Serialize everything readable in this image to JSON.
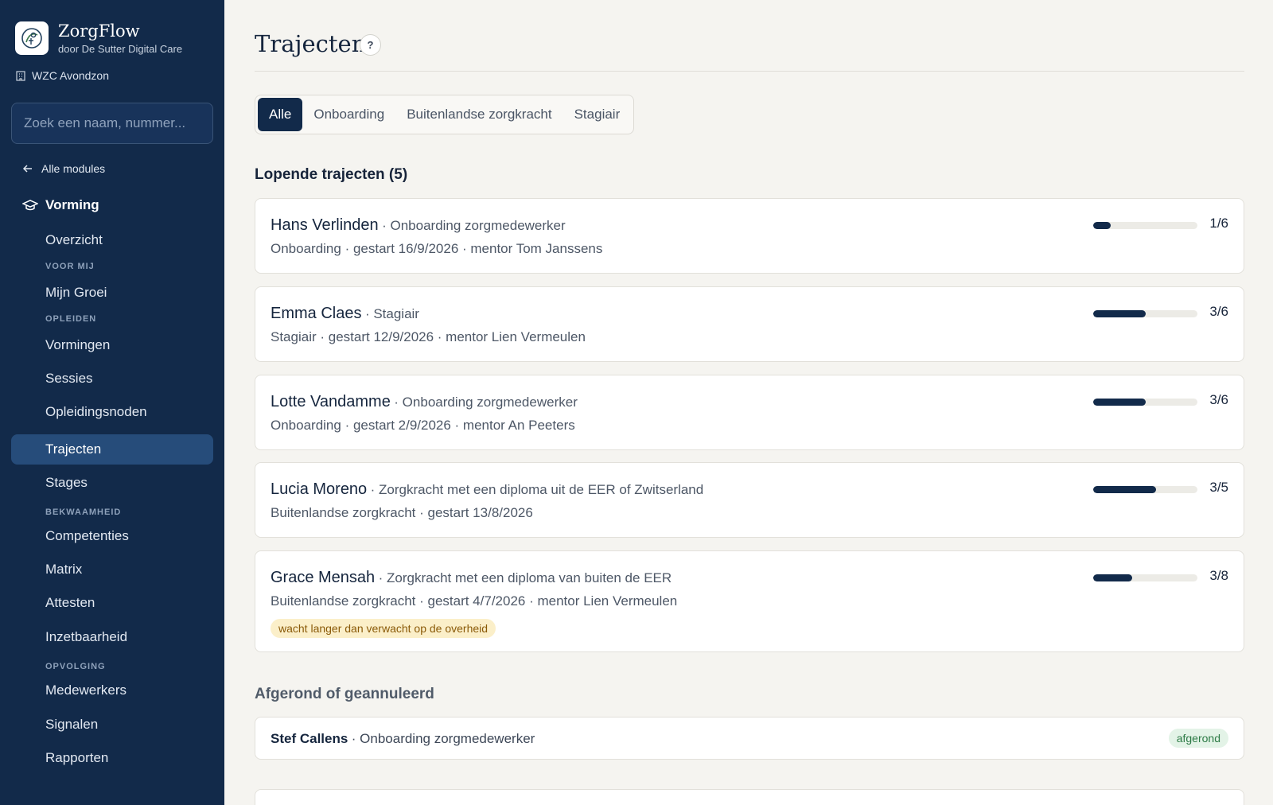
{
  "brand": {
    "name": "ZorgFlow",
    "subtitle": "door De Sutter Digital Care",
    "facility": "WZC Avondzon"
  },
  "search": {
    "placeholder": "Zoek een naam, nummer..."
  },
  "nav": {
    "back_label": "Alle modules",
    "module_label": "Vorming",
    "items": [
      {
        "label": "Overzicht"
      },
      {
        "label": "Mijn Groei"
      },
      {
        "label": "Vormingen"
      },
      {
        "label": "Sessies"
      },
      {
        "label": "Opleidingsnoden"
      },
      {
        "label": "Trajecten",
        "active": true
      },
      {
        "label": "Stages"
      },
      {
        "label": "Competenties"
      },
      {
        "label": "Matrix"
      },
      {
        "label": "Attesten"
      },
      {
        "label": "Inzetbaarheid"
      },
      {
        "label": "Medewerkers"
      },
      {
        "label": "Signalen"
      },
      {
        "label": "Rapporten"
      }
    ],
    "sections": [
      "VOOR MIJ",
      "OPLEIDEN",
      "BEKWAAMHEID",
      "OPVOLGING"
    ]
  },
  "page": {
    "title": "Trajecten",
    "help_label": "?"
  },
  "tabs": [
    {
      "label": "Alle",
      "active": true
    },
    {
      "label": "Onboarding"
    },
    {
      "label": "Buitenlandse zorgkracht"
    },
    {
      "label": "Stagiair"
    }
  ],
  "running": {
    "title": "Lopende trajecten (5)",
    "items": [
      {
        "name": "Hans Verlinden",
        "type": "· Onboarding zorgmedewerker",
        "details": "Onboarding · gestart 16/9/2026 · mentor Tom Janssens",
        "count": "1/6",
        "progress": 0.1667
      },
      {
        "name": "Emma Claes",
        "type": "· Stagiair",
        "details": "Stagiair · gestart 12/9/2026 · mentor Lien Vermeulen",
        "count": "3/6",
        "progress": 0.5
      },
      {
        "name": "Lotte Vandamme",
        "type": "· Onboarding zorgmedewerker",
        "details": "Onboarding · gestart 2/9/2026 · mentor An Peeters",
        "count": "3/6",
        "progress": 0.5
      },
      {
        "name": "Lucia Moreno",
        "type": "· Zorgkracht met een diploma uit de EER of Zwitserland",
        "details": "Buitenlandse zorgkracht · gestart 13/8/2026",
        "count": "3/5",
        "progress": 0.6
      },
      {
        "name": "Grace Mensah",
        "type": "· Zorgkracht met een diploma van buiten de EER",
        "details": "Buitenlandse zorgkracht · gestart 4/7/2026 · mentor Lien Vermeulen",
        "count": "3/8",
        "progress": 0.375,
        "warning": "wacht langer dan verwacht op de overheid"
      }
    ]
  },
  "finished": {
    "title": "Afgerond of geannuleerd",
    "items": [
      {
        "name": "Stef Callens",
        "type": "· Onboarding zorgmedewerker",
        "status": "afgerond"
      }
    ]
  }
}
